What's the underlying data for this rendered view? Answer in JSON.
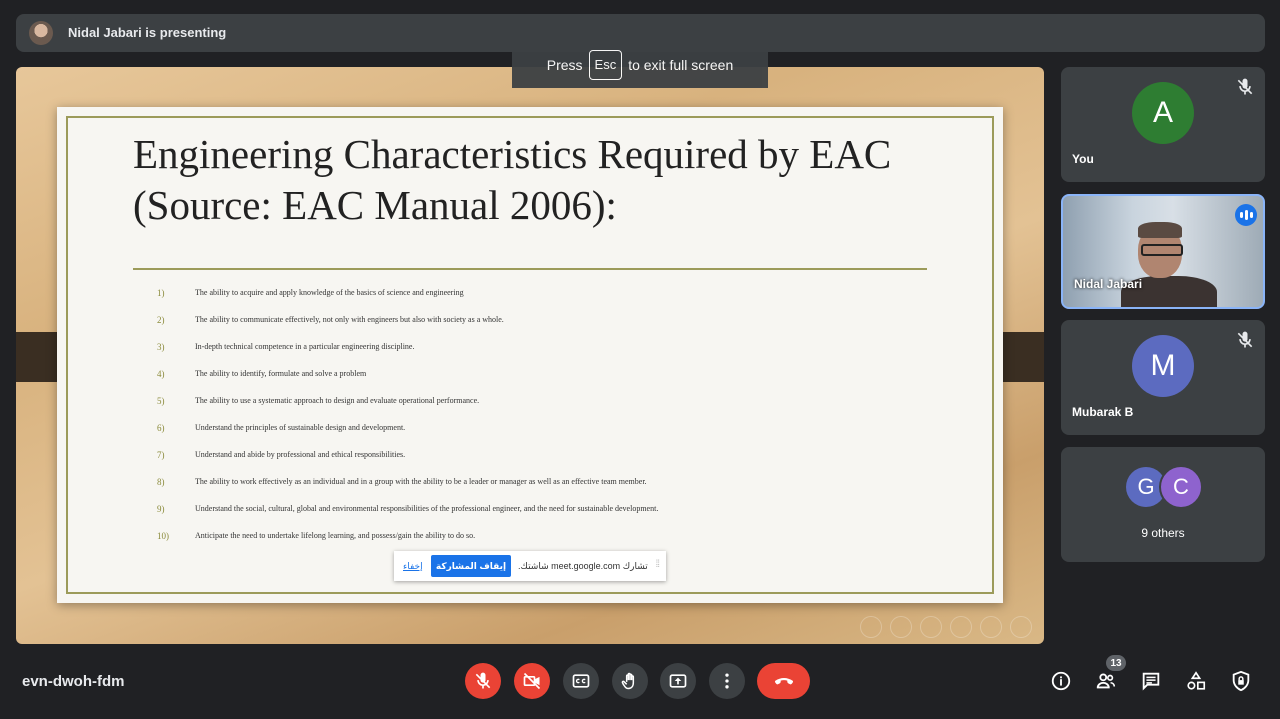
{
  "presenter_bar": {
    "text": "Nidal Jabari is presenting"
  },
  "fullscreen_hint": {
    "before": "Press",
    "key": "Esc",
    "after": "to exit full screen"
  },
  "slide": {
    "title_line1": "Engineering Characteristics Required by EAC",
    "title_line2": "(Source: EAC Manual 2006):",
    "items": [
      {
        "num": "1)",
        "text": "The ability to acquire and apply knowledge of the basics of science and engineering"
      },
      {
        "num": "2)",
        "text": "The ability to communicate effectively, not only with engineers but also with society as a whole."
      },
      {
        "num": "3)",
        "text": "In-depth technical competence in a particular engineering discipline."
      },
      {
        "num": "4)",
        "text": "The ability to identify, formulate and solve a problem"
      },
      {
        "num": "5)",
        "text": "The ability to use a systematic approach to design and evaluate operational performance."
      },
      {
        "num": "6)",
        "text": "Understand the principles of sustainable design and development."
      },
      {
        "num": "7)",
        "text": "Understand and abide by professional and ethical responsibilities."
      },
      {
        "num": "8)",
        "text": "The ability to work effectively as an individual and in a group with the ability to be a leader or manager as well as an effective team member."
      },
      {
        "num": "9)",
        "text": "Understand the social, cultural, global and environmental responsibilities of the professional engineer, and the need for sustainable development."
      },
      {
        "num": "10)",
        "text": "Anticipate the need to undertake lifelong learning, and possess/gain the ability to do so."
      }
    ]
  },
  "share_bar": {
    "hide": "إخفاء",
    "stop": "إيقاف المشاركة",
    "message": "تشارك meet.google.com شاشتك."
  },
  "participants": {
    "you": {
      "initial": "A",
      "name": "You",
      "color": "#2e7d32"
    },
    "presenter": {
      "name": "Nidal Jabari"
    },
    "mubarak": {
      "initial": "M",
      "name": "Mubarak B",
      "color": "#5c6bc0"
    },
    "others": {
      "initial1": "G",
      "initial2": "C",
      "label": "9 others"
    }
  },
  "bottom_bar": {
    "meeting_code": "evn-dwoh-fdm",
    "participant_count": "13",
    "accent_red": "#ea4335"
  }
}
